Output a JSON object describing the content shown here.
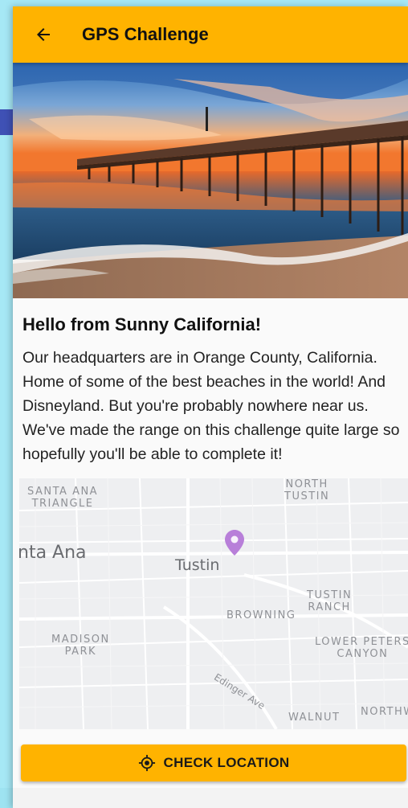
{
  "appbar": {
    "title": "GPS Challenge",
    "back_icon": "arrow-left-icon",
    "color": "#ffb300"
  },
  "hero": {
    "description_icon": "beach-pier-sunset-photo"
  },
  "content": {
    "title": "Hello from Sunny California!",
    "body": "Our headquarters are in Orange County, California. Home of some of the best beaches in the world! And Disneyland. But you're probably nowhere near us. We've made the range on this challenge quite large so hopefully you'll be able to complete it!"
  },
  "map": {
    "labels": {
      "santa_ana_triangle": "SANTA ANA\nTRIANGLE",
      "north_tustin": "NORTH\nTUSTIN",
      "santa_ana": "nta Ana",
      "tustin": "Tustin",
      "tustin_ranch": "TUSTIN\nRANCH",
      "browning": "BROWNING",
      "madison_park": "MADISON\nPARK",
      "lower_peters_canyon": "LOWER PETERS\nCANYON",
      "edinger_ave": "Edinger Ave",
      "walnut": "WALNUT",
      "northwood": "NORTHW"
    },
    "pin_color": "#b87fd9"
  },
  "actions": {
    "check_location_label": "CHECK LOCATION",
    "check_location_icon": "gps-target-icon"
  }
}
